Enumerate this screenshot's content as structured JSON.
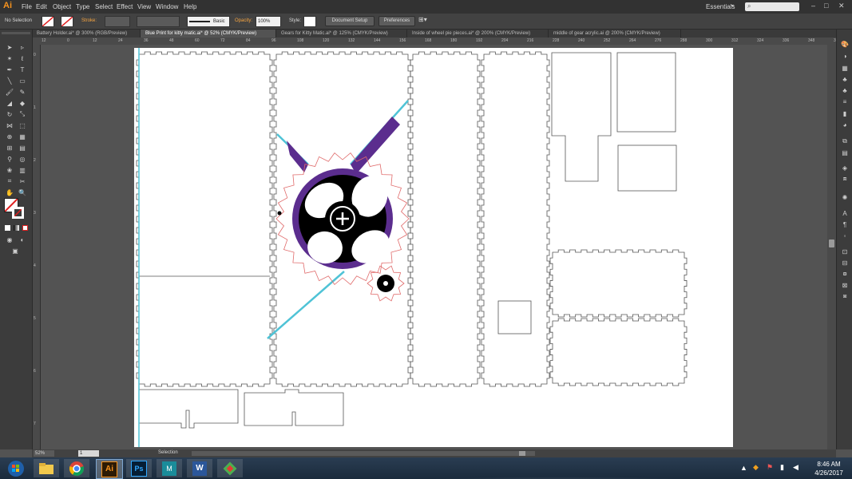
{
  "app": {
    "logo_text": "Ai"
  },
  "menu": [
    "File",
    "Edit",
    "Object",
    "Type",
    "Select",
    "Effect",
    "View",
    "Window",
    "Help"
  ],
  "workspace": {
    "label": "Essentials",
    "search_icon": "search-icon"
  },
  "control_bar": {
    "selection": "No Selection",
    "stroke_label": "Stroke:",
    "brush_label": "Basic",
    "opacity_label": "Opacity:",
    "opacity_value": "100%",
    "style_label": "Style:",
    "document_setup": "Document Setup",
    "preferences": "Preferences"
  },
  "tabs": [
    {
      "label": "Battery Holder.ai* @ 300% (RGB/Preview)",
      "active": false
    },
    {
      "label": "Blue Print for kitty matic.ai* @ 52% (CMYK/Preview)",
      "active": true
    },
    {
      "label": "Gears for Kitty Matic.ai* @ 125% (CMYK/Preview)",
      "active": false
    },
    {
      "label": "Inside of wheel pie pieces.ai* @ 200% (CMYK/Preview)",
      "active": false
    },
    {
      "label": "middle of gear acrylic.ai @ 200% (CMYK/Preview)",
      "active": false
    }
  ],
  "ruler_top": [
    "12",
    "0",
    "12",
    "24",
    "36",
    "48",
    "60",
    "72",
    "84",
    "96",
    "108",
    "120",
    "132",
    "144",
    "156",
    "168",
    "180",
    "192",
    "204",
    "216",
    "228",
    "240",
    "252",
    "264",
    "276",
    "288",
    "300",
    "312",
    "324",
    "336",
    "348",
    "360"
  ],
  "ruler_left": [
    "0",
    "1",
    "2",
    "3",
    "4",
    "5",
    "6",
    "7"
  ],
  "status": {
    "zoom": "52%",
    "page": "1",
    "tool": "Selection"
  },
  "clock": {
    "time": "8:46 AM",
    "date": "4/26/2017"
  },
  "colors": {
    "accent_cyan": "#4fc3d6",
    "purple": "#5b2d8e",
    "gear_outline": "#e06a6a"
  },
  "taskbar_apps": [
    "windows-start-icon",
    "file-explorer-icon",
    "chrome-icon",
    "illustrator-icon",
    "photoshop-icon",
    "maya-icon",
    "word-icon",
    "app-icon"
  ]
}
